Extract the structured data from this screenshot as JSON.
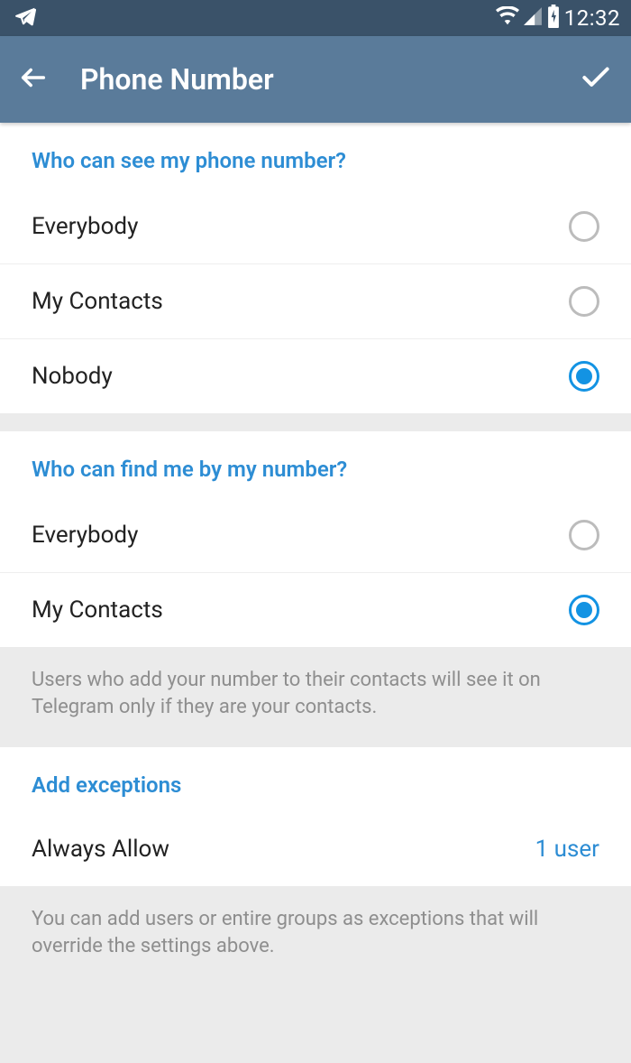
{
  "status": {
    "time": "12:32"
  },
  "header": {
    "title": "Phone Number"
  },
  "section1": {
    "title": "Who can see my phone number?",
    "options": [
      {
        "label": "Everybody",
        "selected": false
      },
      {
        "label": "My Contacts",
        "selected": false
      },
      {
        "label": "Nobody",
        "selected": true
      }
    ]
  },
  "section2": {
    "title": "Who can find me by my number?",
    "options": [
      {
        "label": "Everybody",
        "selected": false
      },
      {
        "label": "My Contacts",
        "selected": true
      }
    ],
    "info": "Users who add your number to their contacts will see it on Telegram only if they are your contacts."
  },
  "section3": {
    "title": "Add exceptions",
    "row_label": "Always Allow",
    "row_value": "1 user",
    "info": "You can add users or entire groups as exceptions that will override the settings above."
  }
}
